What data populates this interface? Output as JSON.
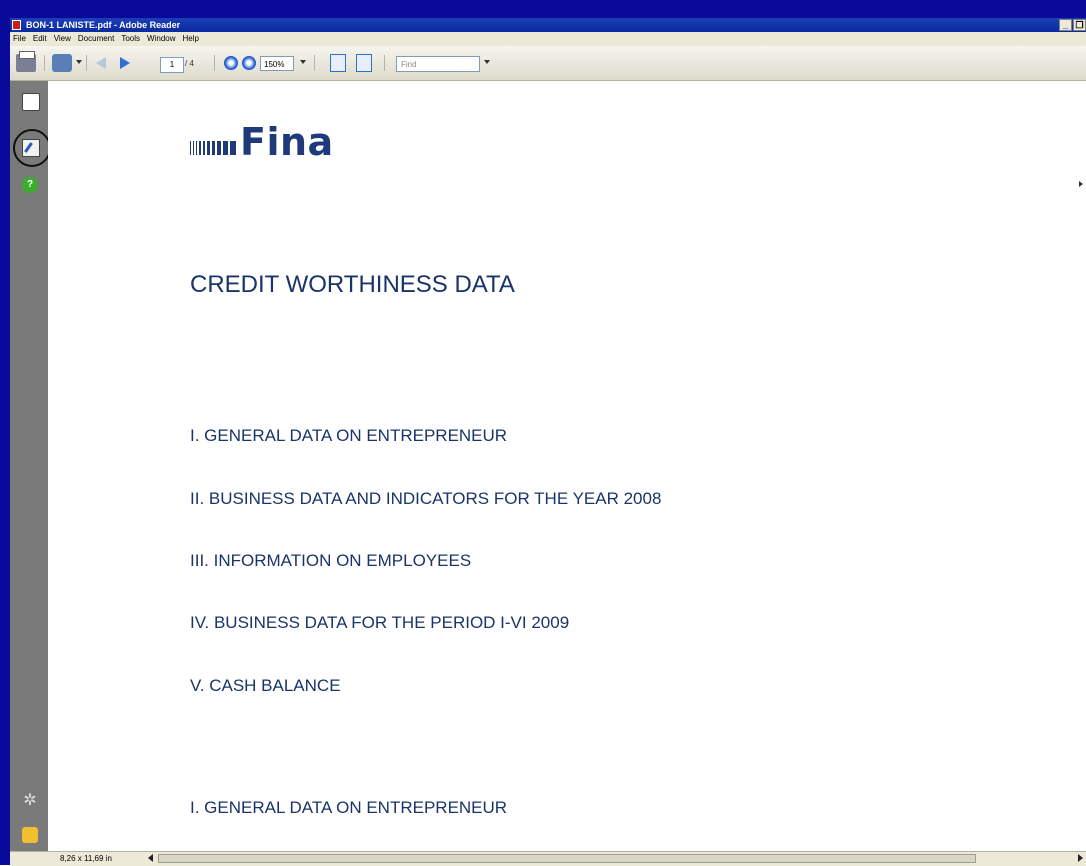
{
  "window": {
    "title": "BON-1 LANISTE.pdf - Adobe Reader",
    "min_label": "_",
    "restore_label": "❐"
  },
  "menu": [
    "File",
    "Edit",
    "View",
    "Document",
    "Tools",
    "Window",
    "Help"
  ],
  "toolbar": {
    "page_current": "1",
    "page_total": "/ 4",
    "zoom": "150%",
    "find_placeholder": "Find"
  },
  "nav": {
    "help_glyph": "?",
    "attach_glyph": "✲"
  },
  "document": {
    "logo_text": "Fina",
    "title": "CREDIT  WORTHINESS DATA",
    "sections": [
      "I. GENERAL DATA ON ENTREPRENEUR",
      "II. BUSINESS DATA AND INDICATORS FOR THE YEAR 2008",
      "III. INFORMATION ON EMPLOYEES",
      "IV. BUSINESS DATA FOR THE PERIOD I-VI 2009",
      "V. CASH BALANCE"
    ],
    "section_heading": "I. GENERAL DATA ON ENTREPRENEUR"
  },
  "status": {
    "page_size": "8,26 x 11,69 in"
  },
  "colors": {
    "frame": "#0a0a9a",
    "text_blue": "#1a3468"
  }
}
